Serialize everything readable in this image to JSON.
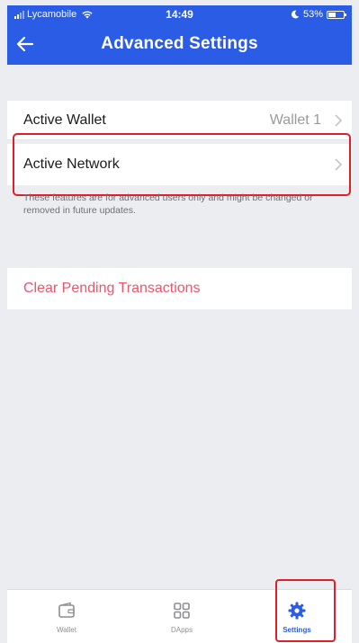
{
  "colors": {
    "header_bg": "#2b5ce6",
    "background": "#ecedf1",
    "destructive_text": "#e9576b",
    "highlight_border": "#e01e2a",
    "active_tab": "#2b5ce6",
    "inactive_tab": "#8e8e93"
  },
  "status_bar": {
    "carrier": "Lycamobile",
    "time": "14:49",
    "battery_percent": "53%",
    "battery_level": 0.53,
    "icons": [
      "signal-icon",
      "wifi-icon",
      "moon-icon",
      "battery-icon"
    ]
  },
  "header": {
    "title": "Advanced Settings",
    "back_icon": "arrow-left-icon"
  },
  "settings": {
    "active_wallet": {
      "label": "Active Wallet",
      "value": "Wallet 1",
      "icon": "chevron-right-icon"
    },
    "active_network": {
      "label": "Active Network",
      "value": "",
      "icon": "chevron-right-icon"
    },
    "notice": "These features are for advanced users only and might be changed or removed in future updates.",
    "clear_pending": {
      "label": "Clear Pending Transactions"
    }
  },
  "tabbar": {
    "tabs": [
      {
        "label": "Wallet",
        "icon": "wallet-icon",
        "active": false
      },
      {
        "label": "DApps",
        "icon": "grid-icon",
        "active": false
      },
      {
        "label": "Settings",
        "icon": "gear-icon",
        "active": true
      }
    ]
  }
}
